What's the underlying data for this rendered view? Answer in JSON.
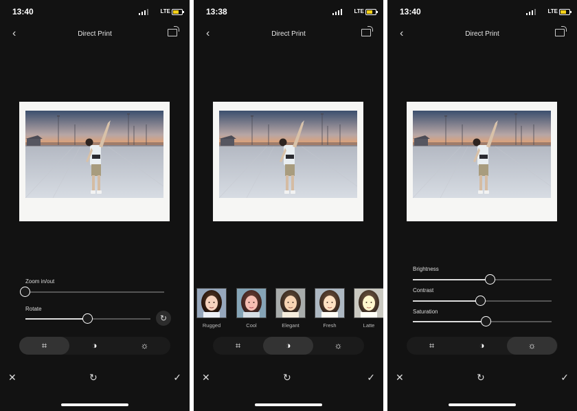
{
  "status": {
    "time_1": "13:40",
    "time_2": "13:38",
    "time_3": "13:40",
    "network": "LTE"
  },
  "header": {
    "title": "Direct Print"
  },
  "screen1": {
    "zoom_label": "Zoom in/out",
    "zoom_value": 0.0,
    "rotate_label": "Rotate",
    "rotate_value": 0.5
  },
  "screen2": {
    "filters": [
      {
        "label": "Rugged"
      },
      {
        "label": "Cool"
      },
      {
        "label": "Elegant"
      },
      {
        "label": "Fresh"
      },
      {
        "label": "Latte"
      }
    ]
  },
  "screen3": {
    "brightness_label": "Brightness",
    "brightness_value": 0.56,
    "contrast_label": "Contrast",
    "contrast_value": 0.49,
    "saturation_label": "Saturation",
    "saturation_value": 0.53
  },
  "tabs": {
    "crop_icon": "crop-icon",
    "filter_icon": "contrast-icon",
    "adjust_icon": "brightness-icon"
  },
  "colors": {
    "background": "#121212",
    "battery": "#f5d11a",
    "accent": "#ffffff"
  }
}
